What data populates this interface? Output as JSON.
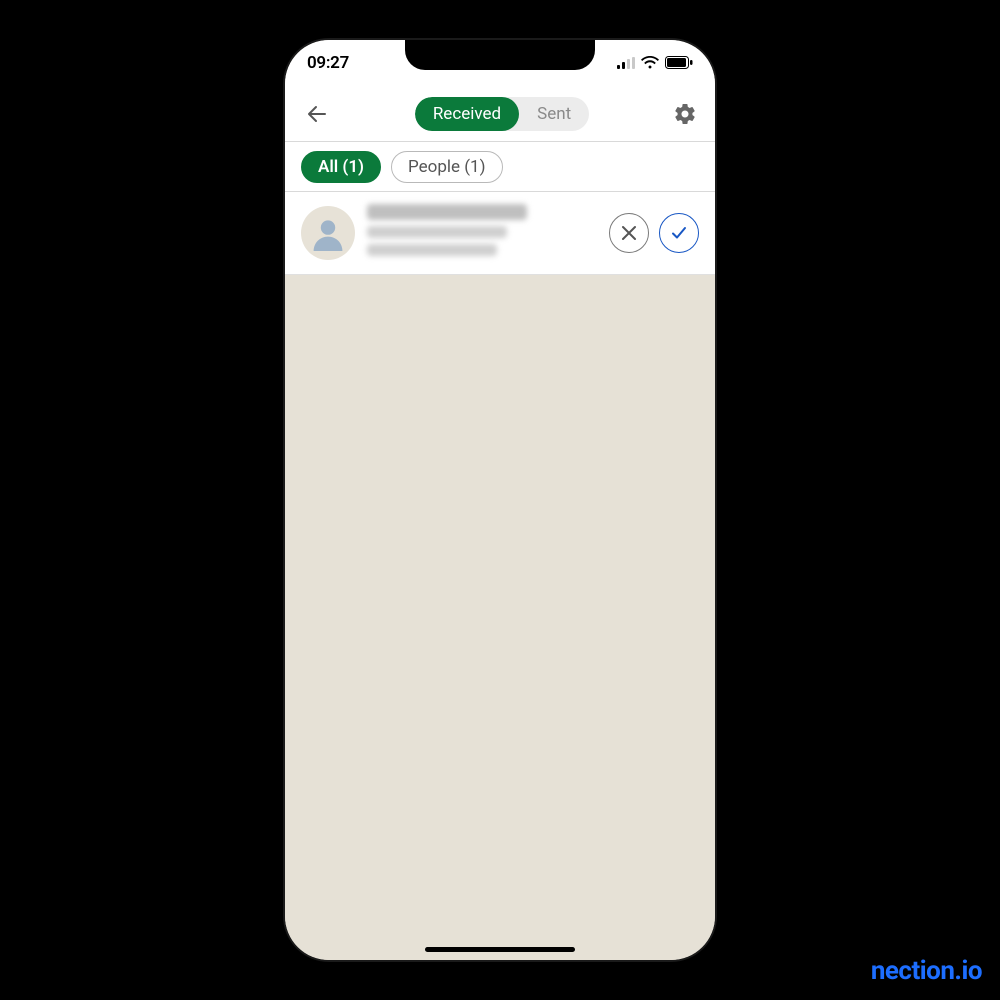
{
  "statusbar": {
    "time": "09:27"
  },
  "topbar": {
    "tabs": [
      {
        "label": "Received",
        "active": true
      },
      {
        "label": "Sent",
        "active": false
      }
    ]
  },
  "filters": [
    {
      "label": "All (1)",
      "active": true
    },
    {
      "label": "People (1)",
      "active": false
    }
  ],
  "invitations": [
    {
      "name_redacted": true,
      "subtitle_redacted": true
    }
  ],
  "watermark": "nection.io",
  "colors": {
    "accent_green": "#0b7a3b",
    "accept_blue": "#1857c4",
    "bg_empty": "#e6e1d6"
  }
}
